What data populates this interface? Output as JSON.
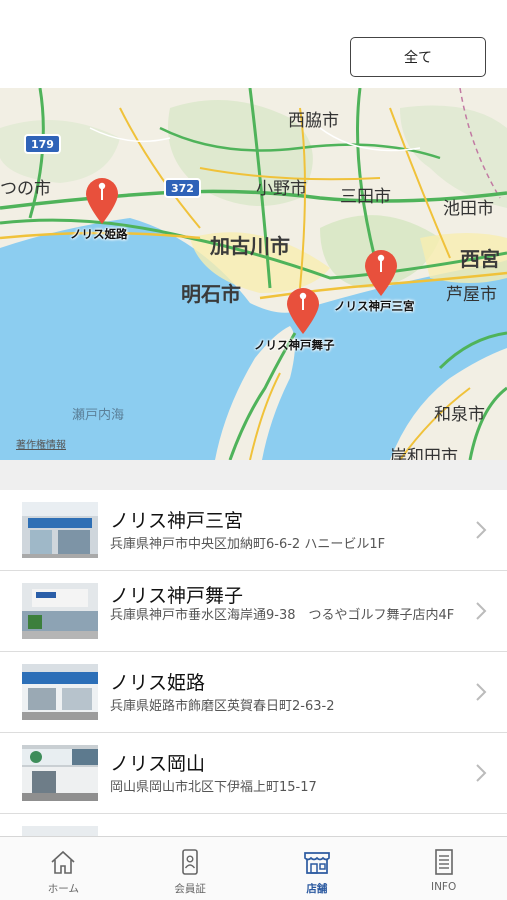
{
  "header": {
    "filter_label": "全て"
  },
  "map": {
    "cities": {
      "nishiwaki": "西脇市",
      "ono": "小野市",
      "sanda": "三田市",
      "ikeda": "池田市",
      "tatsuno": "つの市",
      "kakogawa": "加古川市",
      "nishinomiya": "西宮",
      "ashiya": "芦屋市",
      "akashi": "明石市",
      "izumi": "和泉市",
      "kishiwada": "岸和田市"
    },
    "sea": "瀬戸内海",
    "routes": {
      "r179": "179",
      "r372": "372"
    },
    "credit": "著作権情報",
    "markers": {
      "himeji": "ノリス姫路",
      "sannomiya": "ノリス神戸三宮",
      "maiko": "ノリス神戸舞子"
    },
    "pin_color": "#e8503c",
    "sea_color": "#8ccdf0",
    "land_color": "#f2efe4"
  },
  "stores": [
    {
      "name": "ノリス神戸三宮",
      "address": "兵庫県神戸市中央区加納町6-6-2 ハニービル1F"
    },
    {
      "name": "ノリス神戸舞子",
      "address": "兵庫県神戸市垂水区海岸通9-38　つるやゴルフ舞子店内4F"
    },
    {
      "name": "ノリス姫路",
      "address": "兵庫県姫路市飾磨区英賀春日町2-63-2"
    },
    {
      "name": "ノリス岡山",
      "address": "岡山県岡山市北区下伊福上町15-17"
    }
  ],
  "tabs": [
    {
      "label": "ホーム",
      "icon": "home-icon"
    },
    {
      "label": "会員証",
      "icon": "member-card-icon"
    },
    {
      "label": "店舗",
      "icon": "store-icon",
      "active": true
    },
    {
      "label": "INFO",
      "icon": "info-document-icon"
    }
  ],
  "colors": {
    "accent": "#2c5aa0"
  }
}
